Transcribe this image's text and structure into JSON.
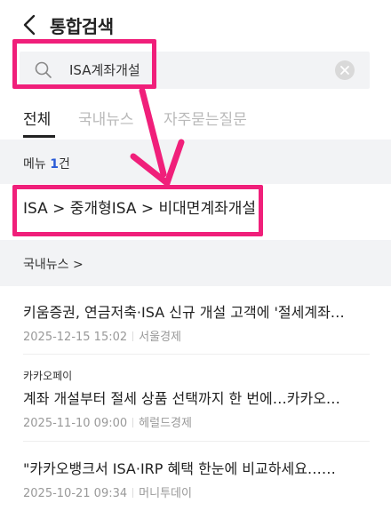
{
  "header": {
    "title": "통합검색"
  },
  "search": {
    "value": "ISA계좌개설"
  },
  "tabs": [
    {
      "label": "전체"
    },
    {
      "label": "국내뉴스"
    },
    {
      "label": "자주묻는질문"
    }
  ],
  "menu_section": {
    "label": "메뉴",
    "count": "1",
    "count_suffix": "건"
  },
  "menu_result": {
    "path": "ISA > 중개형ISA > 비대면계좌개설"
  },
  "news_section": {
    "label": "국내뉴스 >"
  },
  "news": [
    {
      "source_top": "",
      "headline": "키움증권, 연금저축·ISA 신규 개설 고객에 '절세계좌…",
      "date": "2025-12-15 15:02",
      "source": "서울경제"
    },
    {
      "source_top": "카카오페이",
      "headline": "계좌 개설부터 절세 상품 선택까지 한 번에…카카오…",
      "date": "2025-11-10 09:00",
      "source": "헤럴드경제"
    },
    {
      "source_top": "",
      "headline": "\"카카오뱅크서 ISA·IRP 혜택 한눈에 비교하세요……",
      "date": "2025-10-21 09:34",
      "source": "머니투데이"
    }
  ],
  "colors": {
    "highlight": "#f01f7a",
    "count_accent": "#2a5bd7",
    "band": "#f2f3f5"
  },
  "icons": [
    "chevron-left-icon",
    "search-icon",
    "clear-icon"
  ]
}
